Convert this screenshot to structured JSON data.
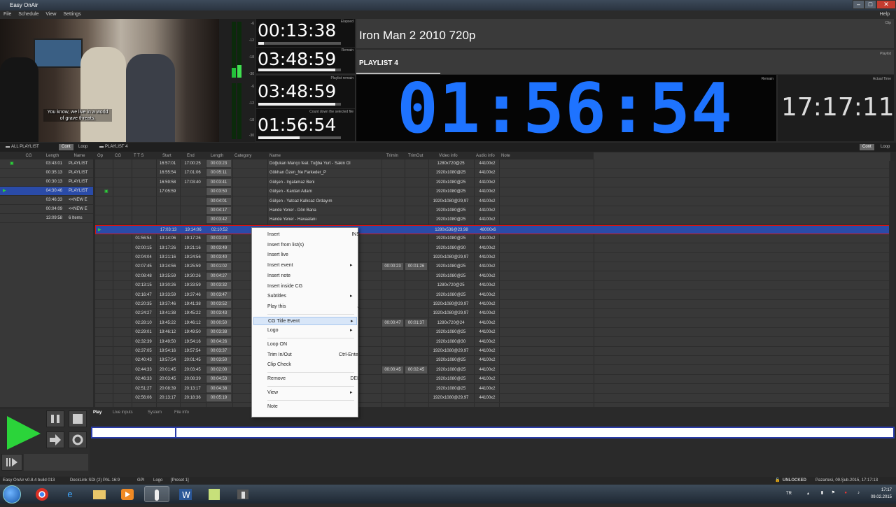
{
  "window": {
    "title": "Easy OnAir",
    "help": "Help"
  },
  "menu": [
    "File",
    "Schedule",
    "View",
    "Settings"
  ],
  "video": {
    "subtitle_line1": "You know, we live in a world",
    "subtitle_line2": "of grave threats."
  },
  "vu_ticks": [
    "-6",
    "-12",
    "-18",
    "-30",
    "-6",
    "-12",
    "-18",
    "-30"
  ],
  "timers": [
    {
      "label": "Elapsed",
      "value": "00:13:38",
      "progress": 0.07
    },
    {
      "label": "Remain",
      "value": "03:48:59",
      "progress": 0.93
    },
    {
      "label": "Playlist remain",
      "value": "03:48:59",
      "progress": 0.93
    },
    {
      "label": "Count down the selected file",
      "value": "01:56:54",
      "progress": 0.5
    }
  ],
  "clip": {
    "label": "Clip",
    "name": "Iron Man 2 2010 720p"
  },
  "playlist": {
    "label": "Playlist",
    "name": "PLAYLIST 4"
  },
  "remain": {
    "label": "Remain",
    "value": "01:56:54"
  },
  "actual": {
    "label": "Actual Time",
    "value": "17:17:11"
  },
  "tabs": {
    "all": "ALL PLAYLIST",
    "cont": "Cont",
    "loop": "Loop",
    "pl4": "PLAYLIST 4"
  },
  "left_headers": [
    "CG",
    "Length",
    "Name"
  ],
  "left_rows": [
    {
      "len": "03:43:01",
      "name": "PLAYLIST",
      "cg": true
    },
    {
      "len": "00:35:13",
      "name": "PLAYLIST"
    },
    {
      "len": "00:30:13",
      "name": "PLAYLIST"
    },
    {
      "len": "04:30:46",
      "name": "PLAYLIST",
      "sel": true
    },
    {
      "len": "03:46:33",
      "name": "<<NEW E"
    },
    {
      "len": "00:04:09",
      "name": "<<NEW E"
    },
    {
      "len": "13:09:58",
      "name": "6 Items"
    }
  ],
  "main_headers": [
    "Op",
    "CG",
    "T T S",
    "Start",
    "End",
    "Length",
    "Category",
    "Name",
    "TrimIn",
    "TrimOut",
    "Video info",
    "Audio info",
    "Note"
  ],
  "main_rows": [
    {
      "tts": "",
      "start": "16:57:01",
      "end": "17:00:25",
      "len": "00:03:23",
      "name": "Doğukan Manço feat. Tuğba Yurt - Sakin Ol",
      "tin": "",
      "tout": "",
      "video": "1280x720@25",
      "audio": "44100x2"
    },
    {
      "tts": "",
      "start": "16:55:54",
      "end": "17:01:06",
      "len": "00:05:11",
      "name": "Gökhan Özen_Ne Farkeder_P",
      "tin": "",
      "tout": "",
      "video": "1920x1080@25",
      "audio": "44100x2"
    },
    {
      "tts": "",
      "start": "16:59:58",
      "end": "17:03:40",
      "len": "00:03:41",
      "name": "Gülşen - Irgalamaz Beni",
      "tin": "",
      "tout": "",
      "video": "1920x1080@25",
      "audio": "44100x2"
    },
    {
      "tts": "",
      "start": "17:05:59",
      "end": "",
      "len": "00:03:50",
      "name": "Gülşen - Kardan Adam",
      "tin": "",
      "tout": "",
      "video": "1920x1080@25",
      "audio": "44100x2"
    },
    {
      "tts": "",
      "start": "",
      "end": "",
      "len": "00:04:01",
      "name": "Gülşen - Yatcaz Kalkcaz Ordayım",
      "tin": "",
      "tout": "",
      "video": "1920x1080@29,97",
      "audio": "44100x2"
    },
    {
      "tts": "",
      "start": "",
      "end": "",
      "len": "00:04:17",
      "name": "Hande Yener - Dön Bana",
      "tin": "",
      "tout": "",
      "video": "1920x1080@25",
      "audio": "44100x2"
    },
    {
      "tts": "",
      "start": "",
      "end": "",
      "len": "00:03:42",
      "name": "Hande Yener - Havaalanı",
      "tin": "",
      "tout": "",
      "video": "1920x1080@25",
      "audio": "44100x2"
    },
    {
      "tts": "",
      "start": "17:03:13",
      "end": "19:14:06",
      "len": "02:10:52",
      "name": "",
      "tin": "",
      "tout": "",
      "video": "1280x536@23,98",
      "audio": "48000x6",
      "sel": true
    },
    {
      "tts": "01:56:54",
      "start": "19:14:06",
      "end": "19:17:26",
      "len": "00:03:20",
      "name": "",
      "tin": "",
      "tout": "",
      "video": "1920x1080@25",
      "audio": "44100x2"
    },
    {
      "tts": "02:00:15",
      "start": "19:17:26",
      "end": "19:21:16",
      "len": "00:03:49",
      "name": "",
      "tin": "",
      "tout": "",
      "video": "1920x1080@30",
      "audio": "44100x2"
    },
    {
      "tts": "02:04:04",
      "start": "19:21:16",
      "end": "19:24:56",
      "len": "00:03:40",
      "name": "",
      "tin": "",
      "tout": "",
      "video": "1920x1080@29,97",
      "audio": "44100x2"
    },
    {
      "tts": "02:07:45",
      "start": "19:24:56",
      "end": "19:25:59",
      "len": "00:01:02",
      "name": "",
      "tin": "00:00:23",
      "tout": "00:01:26",
      "video": "1920x1080@25",
      "audio": "44100x2"
    },
    {
      "tts": "02:08:48",
      "start": "19:25:59",
      "end": "19:30:26",
      "len": "00:04:27",
      "name": "",
      "tin": "",
      "tout": "",
      "video": "1920x1080@25",
      "audio": "44100x2"
    },
    {
      "tts": "02:13:15",
      "start": "19:30:26",
      "end": "19:33:59",
      "len": "00:03:32",
      "name": "",
      "tin": "",
      "tout": "",
      "video": "1280x720@25",
      "audio": "44100x2"
    },
    {
      "tts": "02:16:47",
      "start": "19:33:59",
      "end": "19:37:46",
      "len": "00:03:47",
      "name": "",
      "tin": "",
      "tout": "",
      "video": "1920x1080@25",
      "audio": "44100x2"
    },
    {
      "tts": "02:20:35",
      "start": "19:37:46",
      "end": "19:41:38",
      "len": "00:03:52",
      "name": "",
      "tin": "",
      "tout": "",
      "video": "1920x1080@29,97",
      "audio": "44100x2"
    },
    {
      "tts": "02:24:27",
      "start": "19:41:38",
      "end": "19:45:22",
      "len": "00:03:43",
      "name": "",
      "tin": "",
      "tout": "",
      "video": "1920x1080@29,97",
      "audio": "44100x2"
    },
    {
      "tts": "02:28:10",
      "start": "19:45:22",
      "end": "19:46:12",
      "len": "00:00:50",
      "name": "",
      "tin": "00:00:47",
      "tout": "00:01:37",
      "video": "1280x720@24",
      "audio": "44100x2"
    },
    {
      "tts": "02:29:01",
      "start": "19:46:12",
      "end": "19:49:50",
      "len": "00:03:38",
      "name": "",
      "tin": "",
      "tout": "",
      "video": "1920x1080@25",
      "audio": "44100x2"
    },
    {
      "tts": "02:32:39",
      "start": "19:49:50",
      "end": "19:54:16",
      "len": "00:04:26",
      "name": "",
      "tin": "",
      "tout": "",
      "video": "1920x1080@30",
      "audio": "44100x2"
    },
    {
      "tts": "02:37:05",
      "start": "19:54:16",
      "end": "19:57:54",
      "len": "00:03:37",
      "name": "",
      "tin": "",
      "tout": "",
      "video": "1920x1080@29,97",
      "audio": "44100x2"
    },
    {
      "tts": "02:40:43",
      "start": "19:57:54",
      "end": "20:01:45",
      "len": "00:03:50",
      "name": "",
      "tin": "",
      "tout": "",
      "video": "1920x1080@25",
      "audio": "44100x2"
    },
    {
      "tts": "02:44:33",
      "start": "20:01:45",
      "end": "20:03:45",
      "len": "00:02:00",
      "name": "",
      "tin": "00:00:45",
      "tout": "00:02:45",
      "video": "1920x1080@25",
      "audio": "44100x2"
    },
    {
      "tts": "02:46:33",
      "start": "20:03:45",
      "end": "20:08:39",
      "len": "00:04:53",
      "name": "",
      "tin": "",
      "tout": "",
      "video": "1920x1080@25",
      "audio": "44100x2"
    },
    {
      "tts": "02:51:27",
      "start": "20:08:39",
      "end": "20:13:17",
      "len": "00:04:38",
      "name": "",
      "tin": "",
      "tout": "",
      "video": "1920x1080@25",
      "audio": "44100x2"
    },
    {
      "tts": "02:56:06",
      "start": "20:13:17",
      "end": "20:18:36",
      "len": "00:05:19",
      "name": "",
      "tin": "",
      "tout": "",
      "video": "1920x1080@29,97",
      "audio": "44100x2"
    }
  ],
  "context_menu": [
    {
      "label": "Insert",
      "shortcut": "INS",
      "sub": false
    },
    {
      "label": "Insert from list(s)",
      "shortcut": "",
      "sub": false
    },
    {
      "label": "Insert live",
      "shortcut": "",
      "sub": false
    },
    {
      "label": "Insert event",
      "shortcut": "",
      "sub": true
    },
    {
      "label": "Insert note",
      "shortcut": "",
      "sub": false
    },
    {
      "label": "Insert inside CG",
      "shortcut": "",
      "sub": false
    },
    {
      "label": "Subtitles",
      "shortcut": "",
      "sub": true
    },
    {
      "label": "Play this",
      "shortcut": "J",
      "sub": false
    },
    {
      "label": "CG Title Event",
      "shortcut": "",
      "sub": true,
      "hover": true
    },
    {
      "label": "Logo",
      "shortcut": "",
      "sub": true
    },
    {
      "label": "Loop ON",
      "shortcut": "",
      "sub": false
    },
    {
      "label": "Trim In/Out",
      "shortcut": "Ctrl-Enter",
      "sub": false
    },
    {
      "label": "Clip Check",
      "shortcut": "",
      "sub": false
    },
    {
      "label": "Remove",
      "shortcut": "DEL",
      "sub": false
    },
    {
      "label": "View",
      "shortcut": "",
      "sub": true
    },
    {
      "label": "Note",
      "shortcut": "",
      "sub": false
    }
  ],
  "bottom_tabs": [
    "Play",
    "Live inputs",
    "System",
    "File info"
  ],
  "status": {
    "left": "Easy OnAir v0.8.4 build 013",
    "deck": "DeckLink SDI (2) PAL 16:9",
    "gpi": "GPI",
    "logo": "Logo",
    "preset": "[Preset 1]",
    "lock": "UNLOCKED",
    "date": "Pazartesi, 09.Şub.2015, 17:17:13"
  },
  "taskbar": {
    "lang": "TR",
    "time": "17:17",
    "date": "09.02.2015"
  },
  "colors": {
    "accent_blue": "#1e73ff",
    "selection": "#2a4ba8",
    "play_green": "#2bd43a"
  }
}
